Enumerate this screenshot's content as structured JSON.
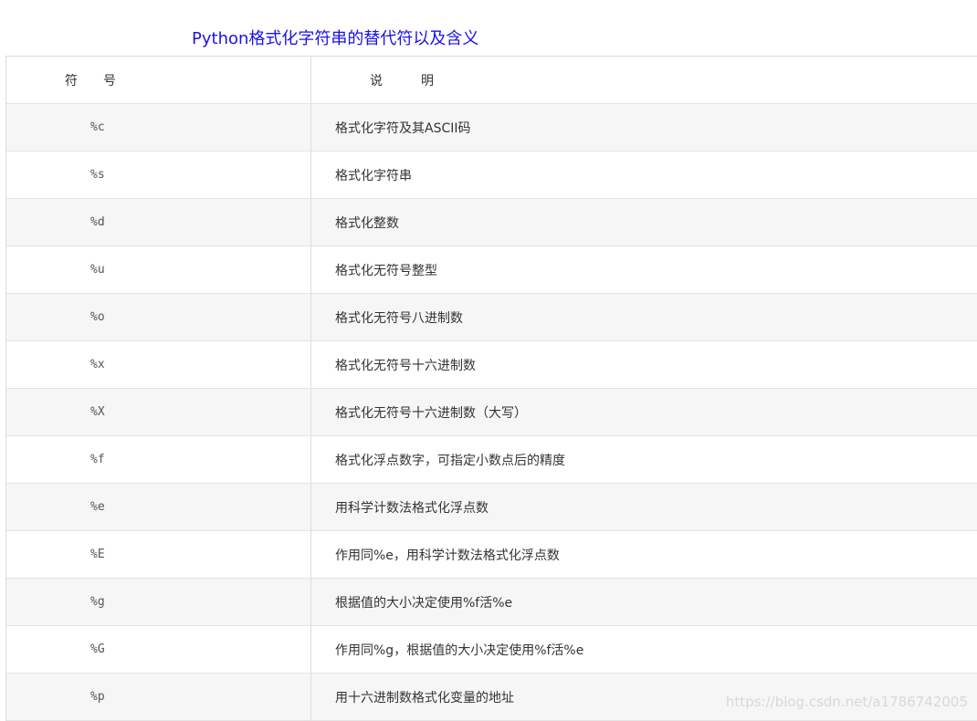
{
  "caption": "Python格式化字符串的替代符以及含义",
  "table": {
    "headers": {
      "symbol": "符　　号",
      "description": "说　　　明"
    },
    "rows": [
      {
        "symbol": "%c",
        "description": "格式化字符及其ASCII码"
      },
      {
        "symbol": "%s",
        "description": "格式化字符串"
      },
      {
        "symbol": "%d",
        "description": "格式化整数"
      },
      {
        "symbol": "%u",
        "description": "格式化无符号整型"
      },
      {
        "symbol": "%o",
        "description": "格式化无符号八进制数"
      },
      {
        "symbol": "%x",
        "description": "格式化无符号十六进制数"
      },
      {
        "symbol": "%X",
        "description": "格式化无符号十六进制数（大写）"
      },
      {
        "symbol": "%f",
        "description": "格式化浮点数字，可指定小数点后的精度"
      },
      {
        "symbol": "%e",
        "description": "用科学计数法格式化浮点数"
      },
      {
        "symbol": "%E",
        "description": "作用同%e，用科学计数法格式化浮点数"
      },
      {
        "symbol": "%g",
        "description": "根据值的大小决定使用%f活%e"
      },
      {
        "symbol": "%G",
        "description": "作用同%g，根据值的大小决定使用%f活%e"
      },
      {
        "symbol": "%p",
        "description": "用十六进制数格式化变量的地址"
      }
    ]
  },
  "watermark": "https://blog.csdn.net/a1786742005"
}
